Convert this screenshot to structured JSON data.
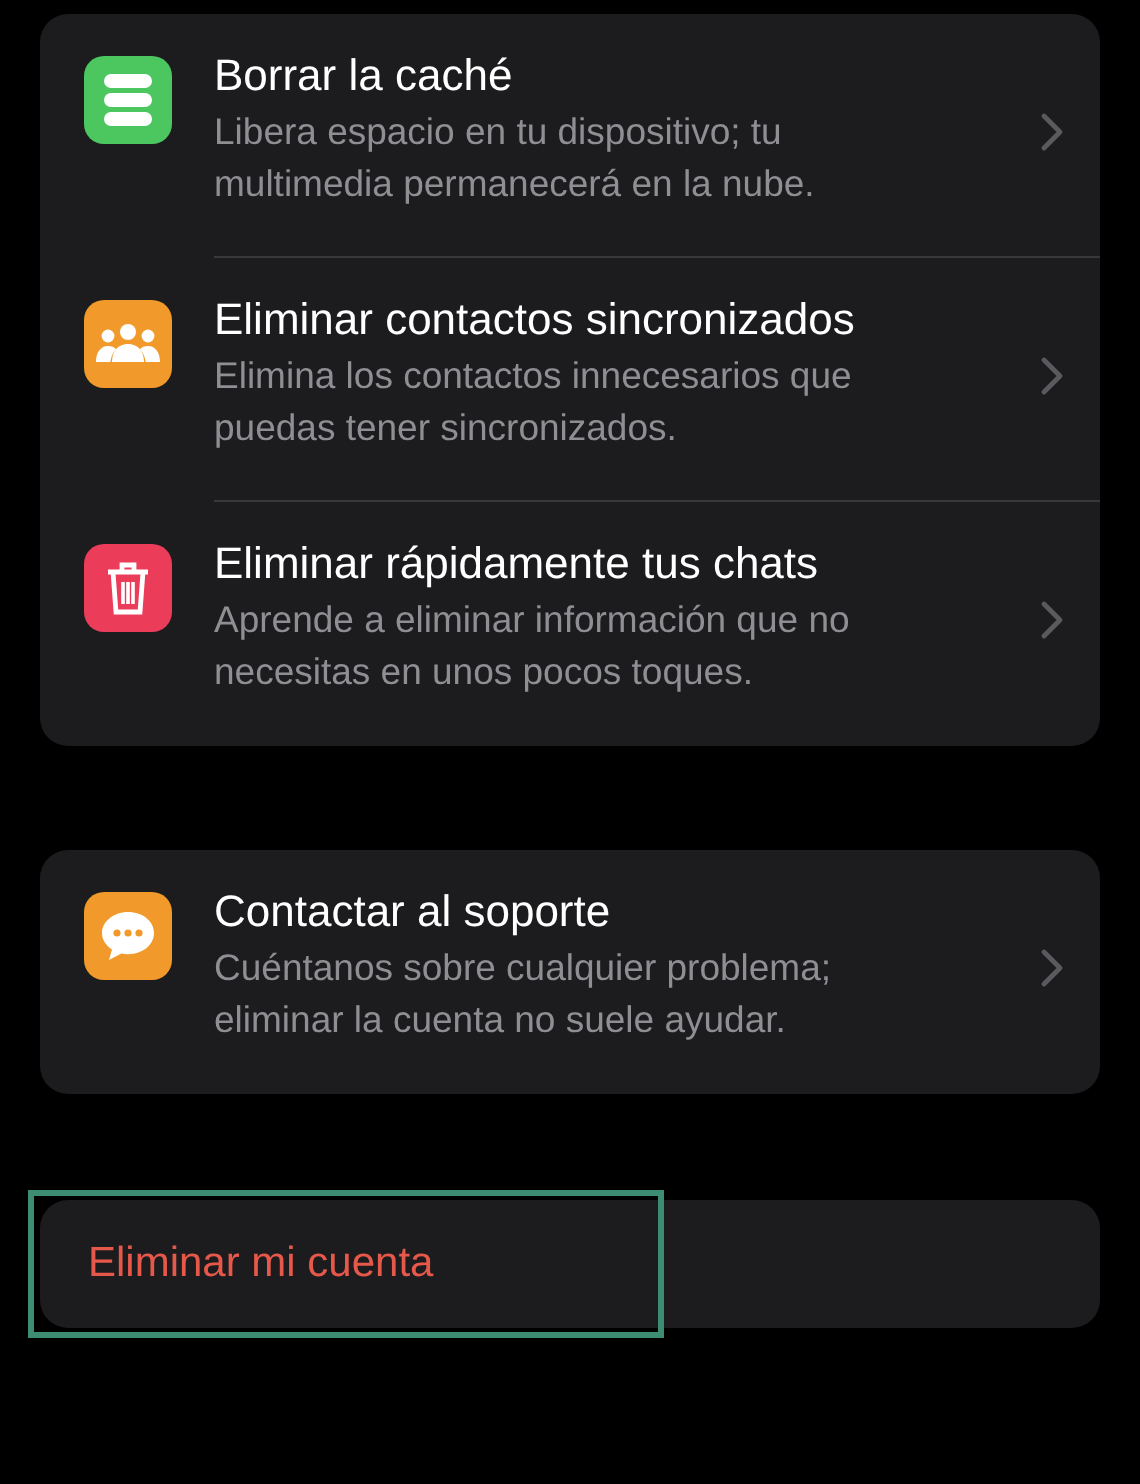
{
  "groups": [
    {
      "items": [
        {
          "kind": "database",
          "color": "#4cc65e",
          "title": "Borrar la caché",
          "subtitle": "Libera espacio en tu dispositivo; tu multimedia permanecerá en la nube."
        },
        {
          "kind": "people",
          "color": "#f19a2b",
          "title": "Eliminar contactos sincronizados",
          "subtitle": "Elimina los contactos innecesarios que puedas tener sincronizados."
        },
        {
          "kind": "trash",
          "color": "#eb3c5a",
          "title": "Eliminar rápidamente tus chats",
          "subtitle": "Aprende a eliminar información que no necesitas en unos pocos toques."
        }
      ]
    },
    {
      "items": [
        {
          "kind": "chat",
          "color": "#f19a2b",
          "title": "Contactar al soporte",
          "subtitle": "Cuéntanos sobre cualquier problema; eliminar la cuenta no suele ayudar."
        }
      ]
    }
  ],
  "delete_account": {
    "label": "Eliminar mi cuenta",
    "highlighted": true
  }
}
